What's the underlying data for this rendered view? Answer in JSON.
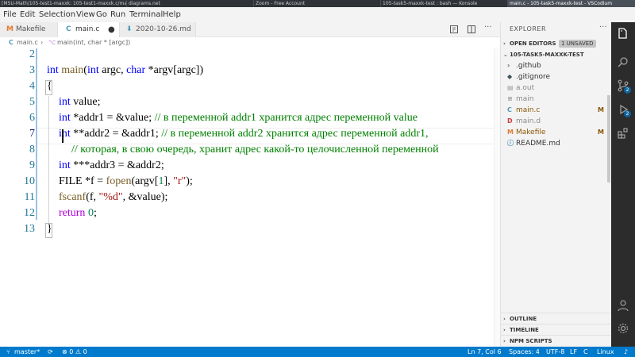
{
  "taskbar": {
    "items": [
      "[MSU-Math/105-test1-maxxk: 105-test1-maxxk.c/ma...",
      "diagrams.net",
      "Zoom - Free Account",
      "105-task5-maxxk-test : bash — Konsole",
      "main.c - 105-task5-maxxk-test - VSCodium"
    ]
  },
  "menubar": {
    "items": [
      "File",
      "Edit",
      "Selection",
      "View",
      "Go",
      "Run",
      "Terminal",
      "Help"
    ]
  },
  "tabs": [
    {
      "icon": "M",
      "label": "Makefile"
    },
    {
      "icon": "C",
      "label": "main.c",
      "dirty": "●"
    },
    {
      "icon": "⬇",
      "label": "2020-10-26.md"
    }
  ],
  "breadcrumb": {
    "file": "main.c",
    "symbol": "main(int, char * [argc])"
  },
  "editor": {
    "line_numbers": [
      "2",
      "3",
      "4",
      "5",
      "6",
      "7",
      "8",
      "9",
      "10",
      "11",
      "12",
      "13"
    ],
    "current_line": "7",
    "lines": {
      "l3": {
        "kw1": "int",
        "fn": "main",
        "p1": "(",
        "kw2": "int",
        "p2": " argc, ",
        "kw3": "char",
        "p3": " *argv[argc])"
      },
      "l4": {
        "text": "{"
      },
      "l5": {
        "kw": "int",
        "rest": " value;"
      },
      "l6": {
        "kw": "int",
        "rest": " *addr1 = &value; ",
        "comment": "// в переменной addr1 хранится адрес переменной value"
      },
      "l7": {
        "kw": "int",
        "rest": " **addr2 = &addr1; ",
        "comment": "// в переменной addr2 хранится адрес переменной addr1,"
      },
      "l8": {
        "comment": "// которая, в свою очередь, хранит адрес какой-то целочисленной переменной"
      },
      "l9": {
        "kw": "int",
        "rest": " ***addr3 = &addr2;"
      },
      "l10": {
        "t1": "FILE *f = ",
        "fn": "fopen",
        "t2": "(argv[",
        "num": "1",
        "t3": "], ",
        "str": "\"r\"",
        "t4": ");"
      },
      "l11": {
        "fn": "fscanf",
        "t1": "(f, ",
        "str": "\"%d\"",
        "t2": ", &value);"
      },
      "l12": {
        "kw": "return",
        "num": " 0",
        "t": ";"
      },
      "l13": {
        "text": "}"
      }
    }
  },
  "sidebar": {
    "title": "EXPLORER",
    "more": "···",
    "open_editors": {
      "label": "OPEN EDITORS",
      "badge": "1 UNSAVED"
    },
    "folder": {
      "label": "105-TASK5-MAXXK-TEST"
    },
    "files": [
      {
        "icon": "›",
        "name": ".github",
        "modified": ""
      },
      {
        "icon": "◆",
        "name": ".gitignore",
        "modified": ""
      },
      {
        "icon": "▤",
        "name": "a.out",
        "modified": ""
      },
      {
        "icon": "≡",
        "name": "main",
        "modified": ""
      },
      {
        "icon": "C",
        "name": "main.c",
        "modified": "M"
      },
      {
        "icon": "D",
        "name": "main.d",
        "modified": ""
      },
      {
        "icon": "M",
        "name": "Makefile",
        "modified": "M"
      },
      {
        "icon": "ⓘ",
        "name": "README.md",
        "modified": ""
      }
    ],
    "outline": "OUTLINE",
    "timeline": "TIMELINE",
    "npm_scripts": "NPM SCRIPTS"
  },
  "activity": {
    "scm_badge": "2",
    "debug_badge": "2"
  },
  "statusbar": {
    "branch": "master*",
    "errors": "⊗ 0 ⚠ 0",
    "position": "Ln 7, Col 6",
    "spaces": "Spaces: 4",
    "encoding": "UTF-8",
    "eol": "LF",
    "language": "C",
    "platform": "Linux"
  },
  "colors": {
    "keyword": "#0000ff",
    "function": "#795e26",
    "comment": "#008000",
    "string": "#a31515",
    "number": "#098658",
    "statusbar": "#007acc",
    "activitybar": "#2c2c2c"
  }
}
